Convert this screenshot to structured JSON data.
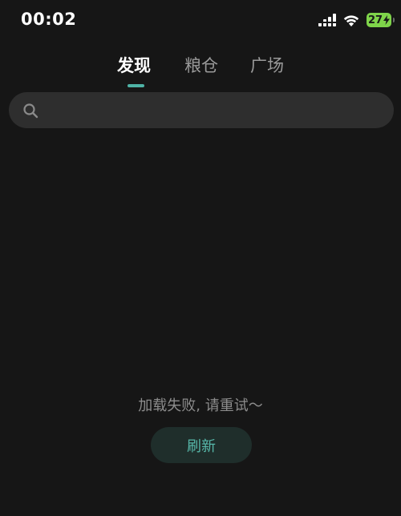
{
  "status_bar": {
    "time": "00:02",
    "battery_level": "27",
    "battery_color": "#7fd44a",
    "icons": [
      "signal-icon",
      "wifi-icon",
      "battery-icon",
      "charging-bolt-icon"
    ]
  },
  "tabs": [
    {
      "label": "发现",
      "active": true
    },
    {
      "label": "粮仓",
      "active": false
    },
    {
      "label": "广场",
      "active": false
    }
  ],
  "search": {
    "icon": "search-icon",
    "value": "",
    "placeholder": ""
  },
  "content": {
    "error_message": "加载失败, 请重试～",
    "refresh_label": "刷新"
  },
  "colors": {
    "background": "#161616",
    "accent": "#4fb3a6",
    "search_background": "#2e2e2e",
    "refresh_button_background": "#1f2e2b",
    "refresh_text": "#57b8aa"
  }
}
